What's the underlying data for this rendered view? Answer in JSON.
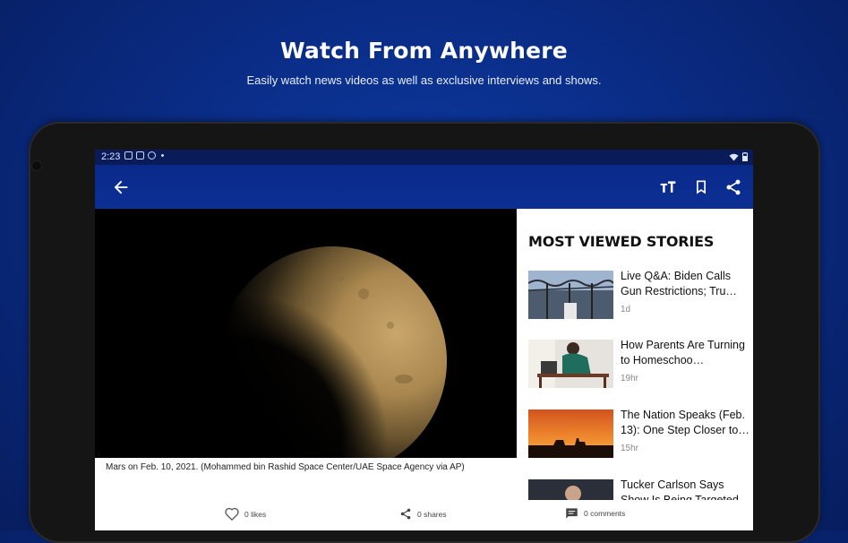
{
  "promo": {
    "headline": "Watch From Anywhere",
    "subline": "Easily watch news videos as well as exclusive interviews and shows."
  },
  "status_bar": {
    "time": "2:23"
  },
  "app_bar": {
    "back_icon": "arrow-left-icon",
    "text_size_icon": "text-size-icon",
    "bookmark_icon": "bookmark-icon",
    "share_icon": "share-icon"
  },
  "media": {
    "caption": "Mars on Feb. 10, 2021. (Mohammed bin Rashid Space Center/UAE Space Agency via AP)"
  },
  "sidebar": {
    "title": "MOST VIEWED STORIES",
    "stories": [
      {
        "title": "Live Q&A: Biden Calls Gun Restrictions; Tru…",
        "age": "1d"
      },
      {
        "title": "How Parents Are Turning to Homeschoo…",
        "age": "19hr"
      },
      {
        "title": "The Nation Speaks (Feb. 13): One Step Closer to…",
        "age": "15hr"
      },
      {
        "title": "Tucker Carlson Says Show Is Being Targeted f…",
        "age": ""
      }
    ]
  },
  "actions": {
    "likes": "0 likes",
    "shares": "0 shares",
    "comments": "0 comments"
  },
  "colors": {
    "background": "#0a2c86",
    "app_bar": "#0c2f94",
    "status_bar": "#0a1b5a"
  }
}
